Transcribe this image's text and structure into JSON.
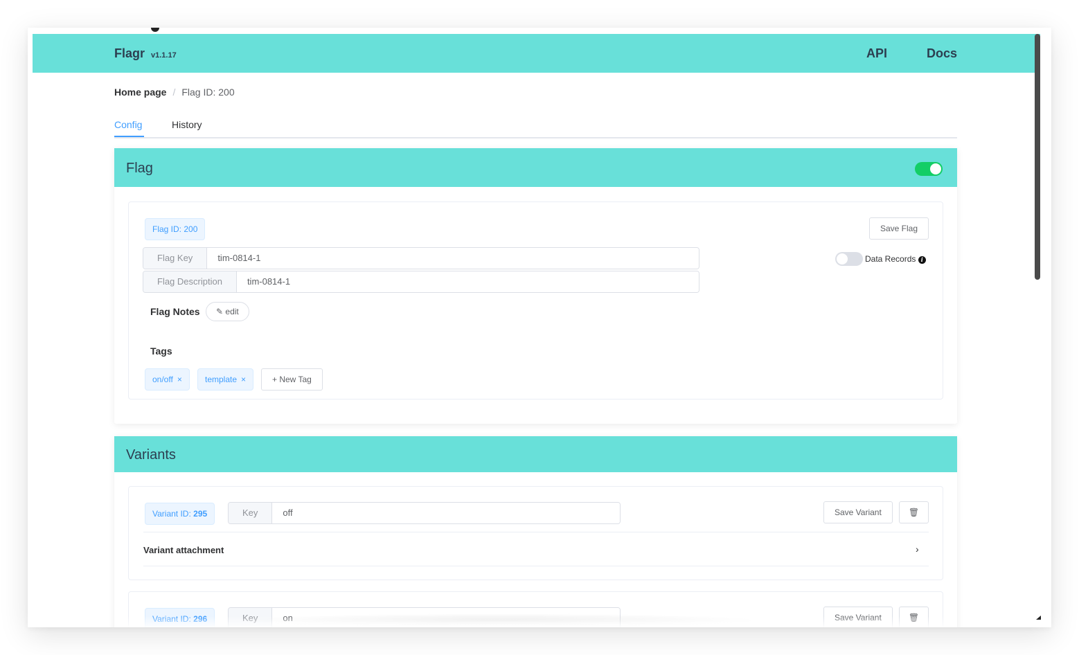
{
  "navbar": {
    "brand": "Flagr",
    "version": "v1.1.17",
    "links": [
      "API",
      "Docs"
    ]
  },
  "breadcrumb": {
    "home": "Home page",
    "separator": "/",
    "current": "Flag ID: 200"
  },
  "tabs": [
    {
      "label": "Config",
      "active": true
    },
    {
      "label": "History",
      "active": false
    }
  ],
  "flag_card": {
    "title": "Flag",
    "enabled": true,
    "id_tag": "Flag ID: 200",
    "save_label": "Save Flag",
    "data_records_label": "Data Records",
    "data_records_enabled": false,
    "info_icon": "info-icon",
    "key_label": "Flag Key",
    "key_value": "tim-0814-1",
    "description_label": "Flag Description",
    "description_value": "tim-0814-1",
    "notes_label": "Flag Notes",
    "notes_edit_label": "edit",
    "tags_label": "Tags",
    "tags": [
      "on/off",
      "template"
    ],
    "new_tag_label": "+ New Tag"
  },
  "variants_card": {
    "title": "Variants",
    "variants": [
      {
        "id_prefix": "Variant ID: ",
        "id": "295",
        "key_label": "Key",
        "key_value": "off",
        "save_label": "Save Variant",
        "attachment_label": "Variant attachment"
      },
      {
        "id_prefix": "Variant ID: ",
        "id": "296",
        "key_label": "Key",
        "key_value": "on",
        "save_label": "Save Variant"
      }
    ]
  },
  "colors": {
    "accent": "#68e0d9",
    "primary": "#409eff",
    "switch_on": "#13ce66"
  }
}
